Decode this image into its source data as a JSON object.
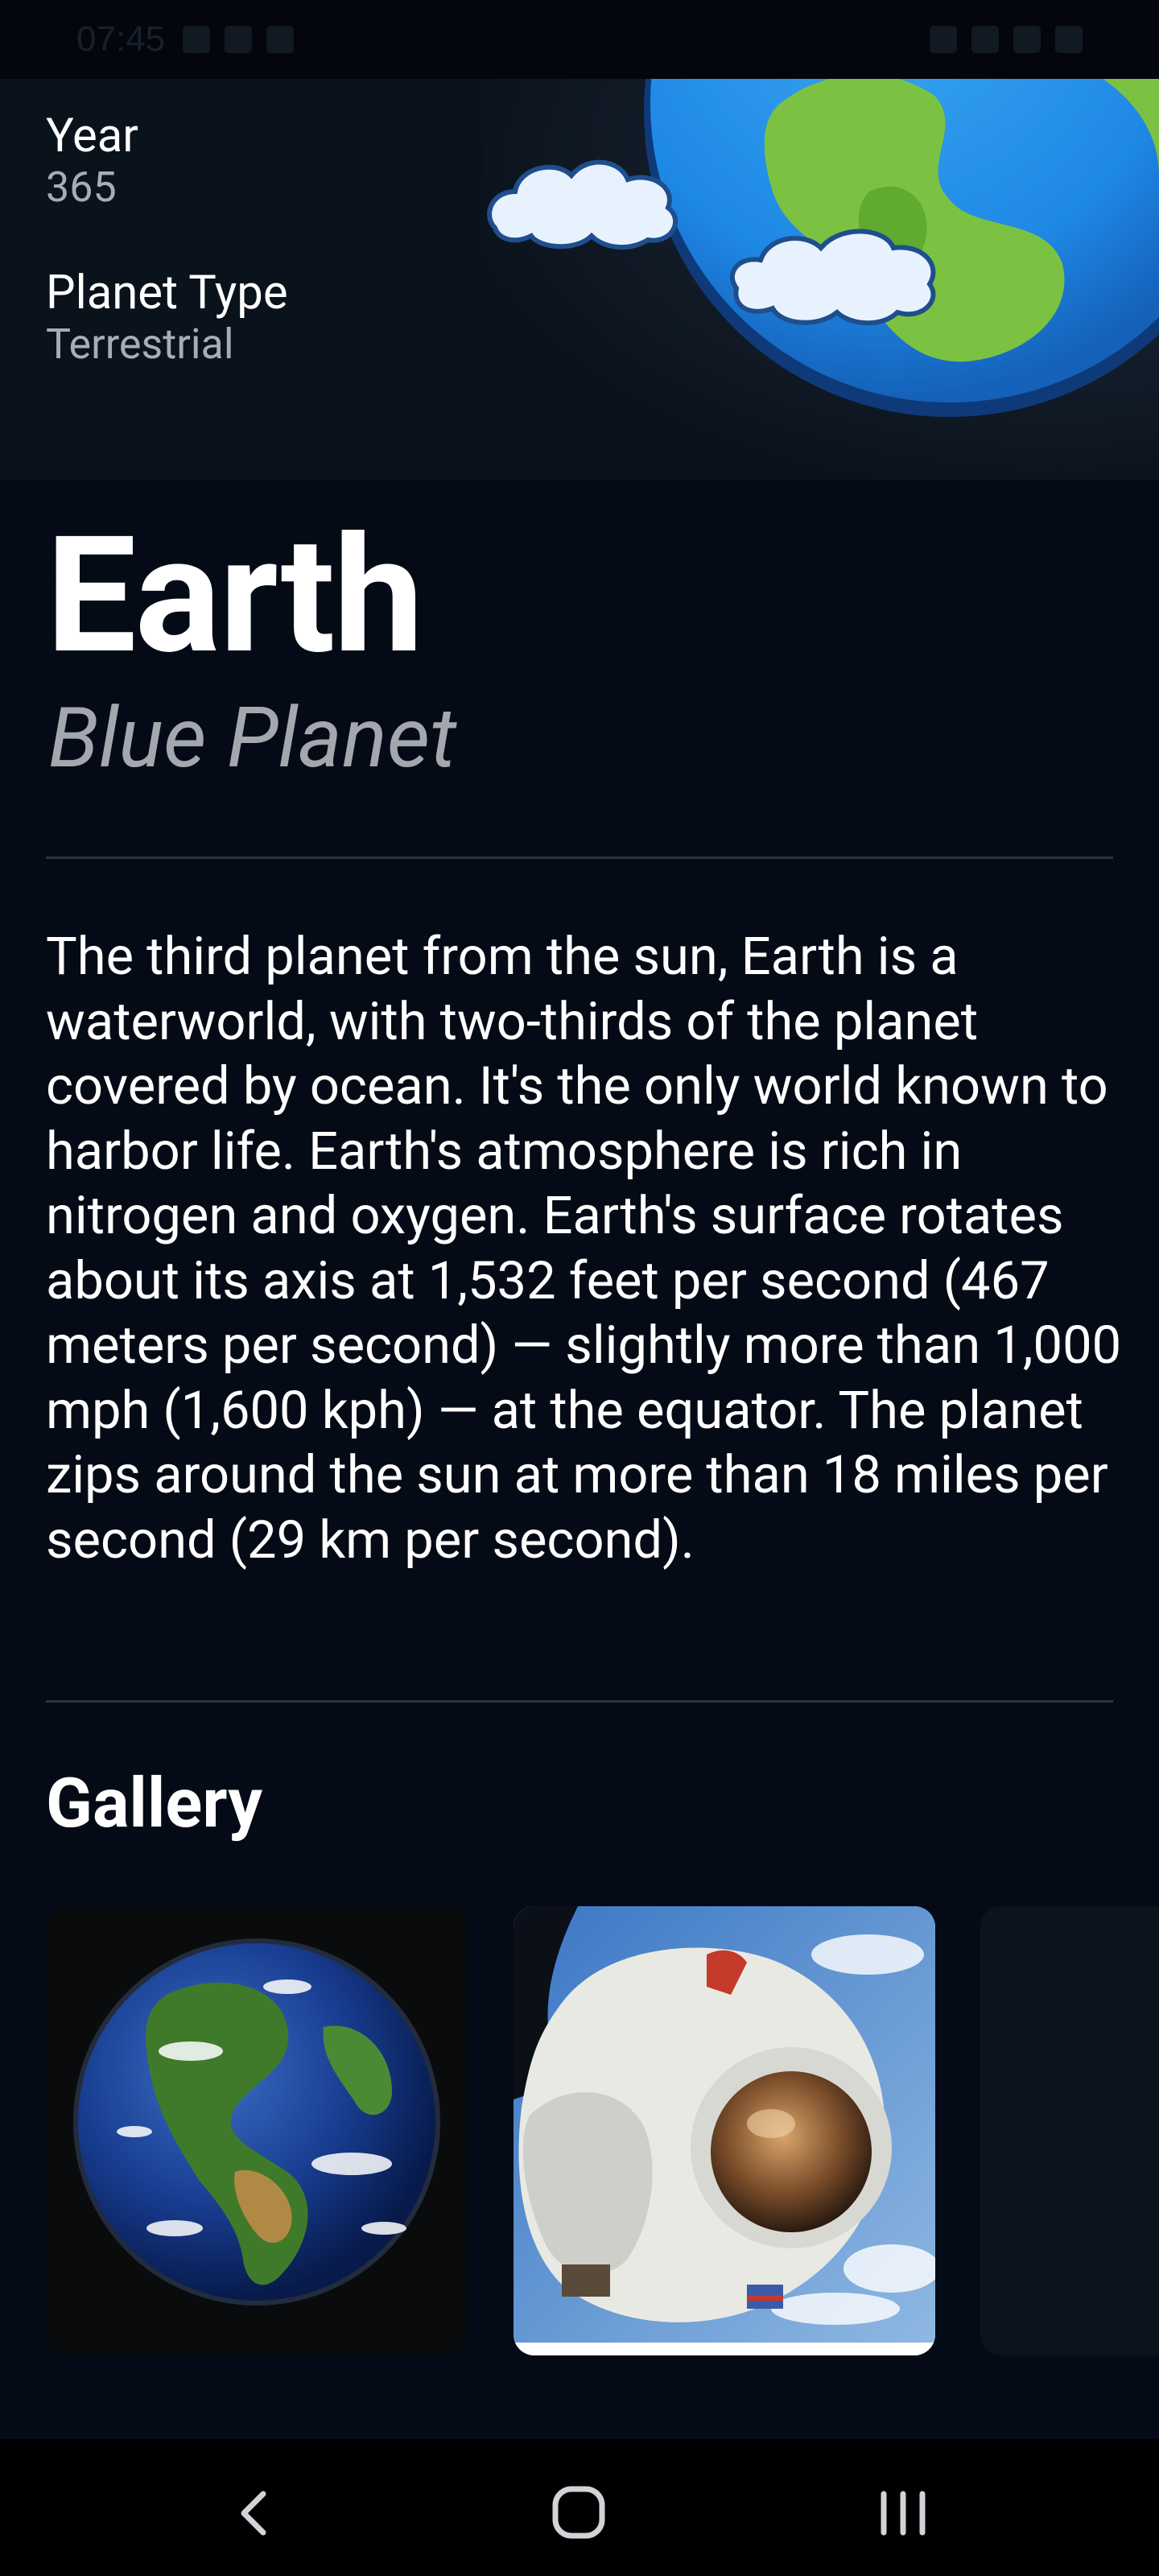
{
  "status_bar": {
    "time": "07:45"
  },
  "facts": {
    "year_label": "Year",
    "year_value": "365",
    "type_label": "Planet Type",
    "type_value": "Terrestrial"
  },
  "planet": {
    "name": "Earth",
    "nickname": "Blue Planet",
    "description": "The third planet from the sun, Earth is a waterworld, with two-thirds of the planet covered by ocean. It's the only world known to harbor life. Earth's atmosphere is rich in nitrogen and oxygen. Earth's surface rotates about its axis at 1,532 feet per second (467 meters per second) — slightly more than 1,000 mph (1,600 kph) — at the equator. The planet zips around the sun at more than 18 miles per second (29 km per second)."
  },
  "gallery": {
    "title": "Gallery"
  },
  "nav": {
    "back_icon": "chevron-left-icon",
    "home_icon": "home-circle-icon",
    "recents_icon": "recents-bars-icon"
  },
  "colors": {
    "background": "#050b16",
    "header_bg": "#0a121c",
    "muted_text": "#a7adb6",
    "subtitle": "#a4a7ad",
    "divider": "#2a3440",
    "ocean": "#1e88e5",
    "land": "#7cc242"
  }
}
